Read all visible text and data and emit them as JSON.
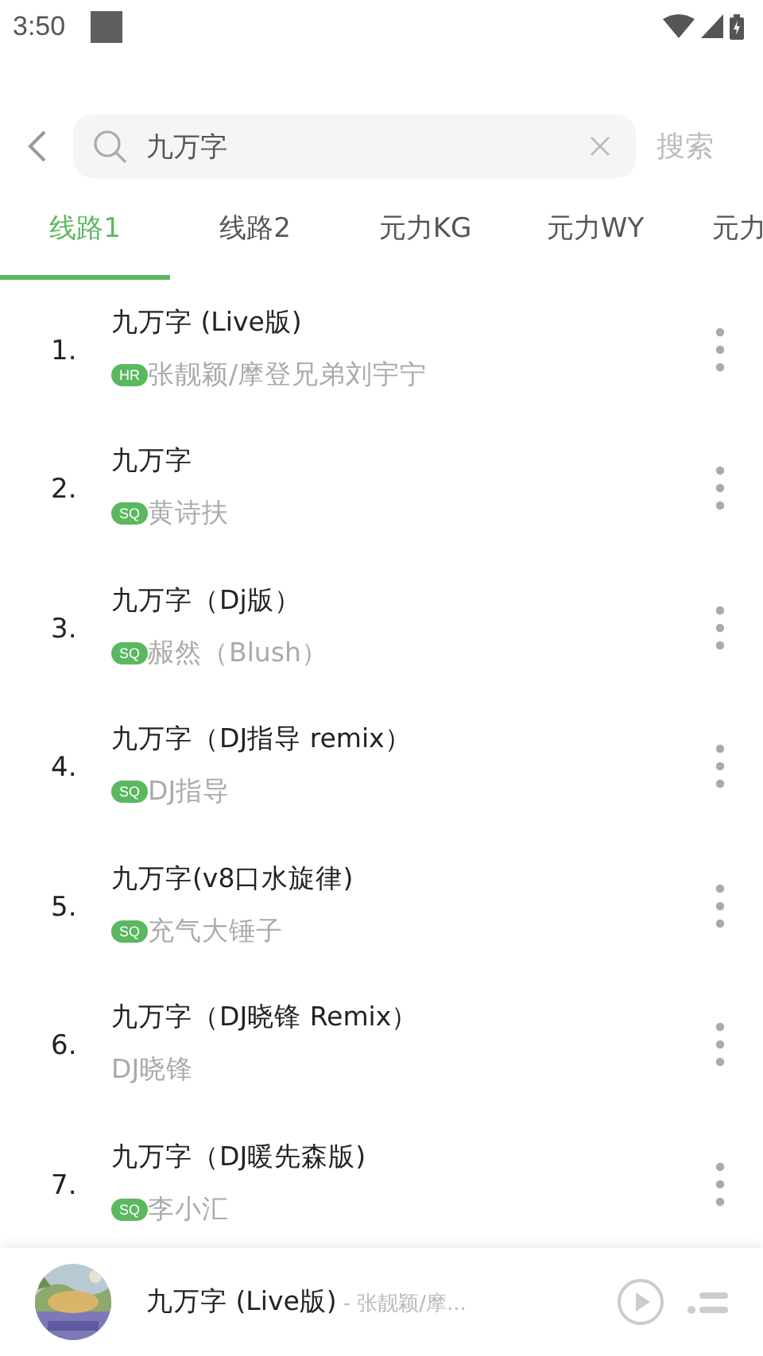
{
  "status_bar": {
    "time": "3:50"
  },
  "search": {
    "value": "九万字",
    "action": "搜索"
  },
  "tabs": [
    {
      "label": "线路1",
      "selected": true
    },
    {
      "label": "线路2",
      "selected": false
    },
    {
      "label": "元力KG",
      "selected": false
    },
    {
      "label": "元力WY",
      "selected": false
    },
    {
      "label": "元力",
      "selected": false
    }
  ],
  "songs": [
    {
      "index": "1.",
      "title": "九万字 (Live版)",
      "quality": "HR",
      "artist": "张靓颖/摩登兄弟刘宇宁"
    },
    {
      "index": "2.",
      "title": "九万字",
      "quality": "SQ",
      "artist": "黄诗扶"
    },
    {
      "index": "3.",
      "title": "九万字（Dj版）",
      "quality": "SQ",
      "artist": "赧然（Blush）"
    },
    {
      "index": "4.",
      "title": "九万字（DJ指导 remix）",
      "quality": "SQ",
      "artist": "DJ指导"
    },
    {
      "index": "5.",
      "title": "九万字(v8口水旋律)",
      "quality": "SQ",
      "artist": "充气大锤子"
    },
    {
      "index": "6.",
      "title": "九万字（DJ晓锋 Remix）",
      "artist": "DJ晓锋"
    },
    {
      "index": "7.",
      "title": "九万字（DJ暖先森版)",
      "quality": "SQ",
      "artist": "李小汇"
    }
  ],
  "player": {
    "title": "九万字 (Live版)",
    "artist": "- 张靓颖/摩..."
  }
}
